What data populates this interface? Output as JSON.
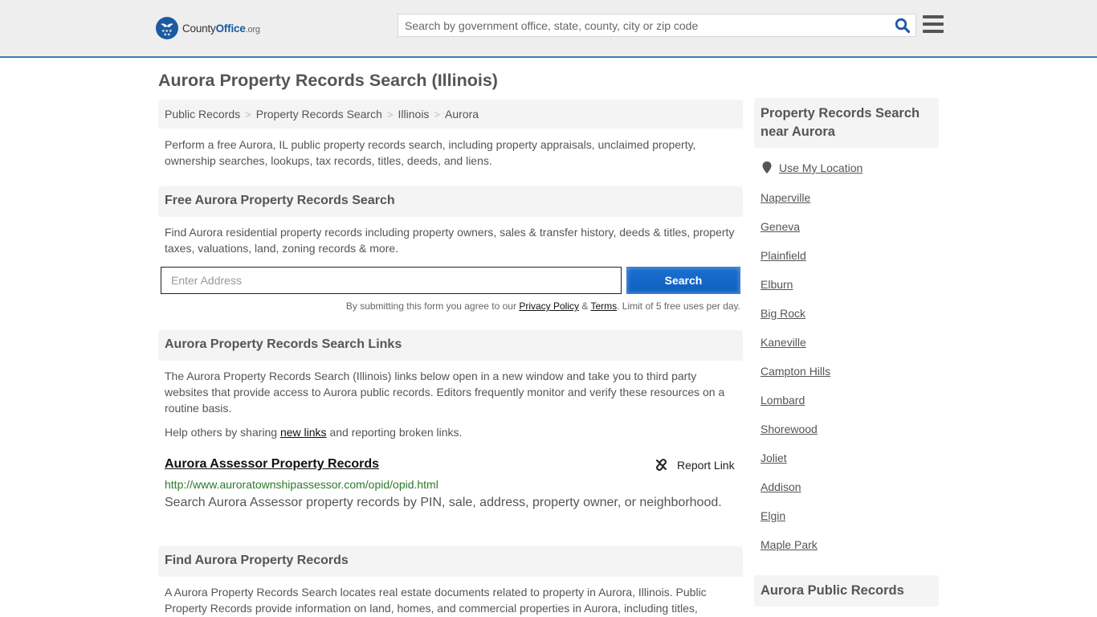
{
  "header": {
    "logo": {
      "brand_a": "County",
      "brand_b": "Office",
      "brand_c": ".org"
    },
    "search": {
      "placeholder": "Search by government office, state, county, city or zip code"
    },
    "icons": {
      "search": "search-icon",
      "menu": "hamburger-menu-icon"
    }
  },
  "page": {
    "title": "Aurora Property Records Search (Illinois)",
    "breadcrumb": [
      {
        "label": "Public Records"
      },
      {
        "label": "Property Records Search"
      },
      {
        "label": "Illinois"
      },
      {
        "label": "Aurora"
      }
    ],
    "breadcrumb_separator": ">",
    "intro": "Perform a free Aurora, IL public property records search, including property appraisals, unclaimed property, ownership searches, lookups, tax records, titles, deeds, and liens."
  },
  "free_search": {
    "heading": "Free Aurora Property Records Search",
    "description": "Find Aurora residential property records including property owners, sales & transfer history, deeds & titles, property taxes, valuations, land, zoning records & more.",
    "address_placeholder": "Enter Address",
    "button_label": "Search",
    "disclaimer_prefix": "By submitting this form you agree to our ",
    "privacy_label": "Privacy Policy",
    "amp": " & ",
    "terms_label": "Terms",
    "disclaimer_suffix": ". Limit of 5 free uses per day."
  },
  "links_section": {
    "heading": "Aurora Property Records Search Links",
    "description": "The Aurora Property Records Search (Illinois) links below open in a new window and take you to third party websites that provide access to Aurora public records. Editors frequently monitor and verify these resources on a routine basis.",
    "help_prefix": "Help others by sharing ",
    "help_link": "new links",
    "help_suffix": " and reporting broken links.",
    "items": [
      {
        "title": "Aurora Assessor Property Records",
        "url": "http://www.auroratownshipassessor.com/opid/opid.html",
        "description": "Search Aurora Assessor property records by PIN, sale, address, property owner, or neighborhood.",
        "report_label": "Report Link"
      }
    ]
  },
  "find_section": {
    "heading": "Find Aurora Property Records",
    "description": "A Aurora Property Records Search locates real estate documents related to property in Aurora, Illinois. Public Property Records provide information on land, homes, and commercial properties in Aurora, including titles,"
  },
  "sidebar": {
    "nearby_heading": "Property Records Search near Aurora",
    "use_location": "Use My Location",
    "cities": [
      "Naperville",
      "Geneva",
      "Plainfield",
      "Elburn",
      "Big Rock",
      "Kaneville",
      "Campton Hills",
      "Lombard",
      "Shorewood",
      "Joliet",
      "Addison",
      "Elgin",
      "Maple Park"
    ],
    "public_records_heading": "Aurora Public Records"
  },
  "colors": {
    "accent": "#1d5aa0",
    "button": "#0e5fbf",
    "url_green": "#2b7a2b",
    "header_bg": "#eeeeee",
    "panel_bg": "#f4f4f4"
  }
}
